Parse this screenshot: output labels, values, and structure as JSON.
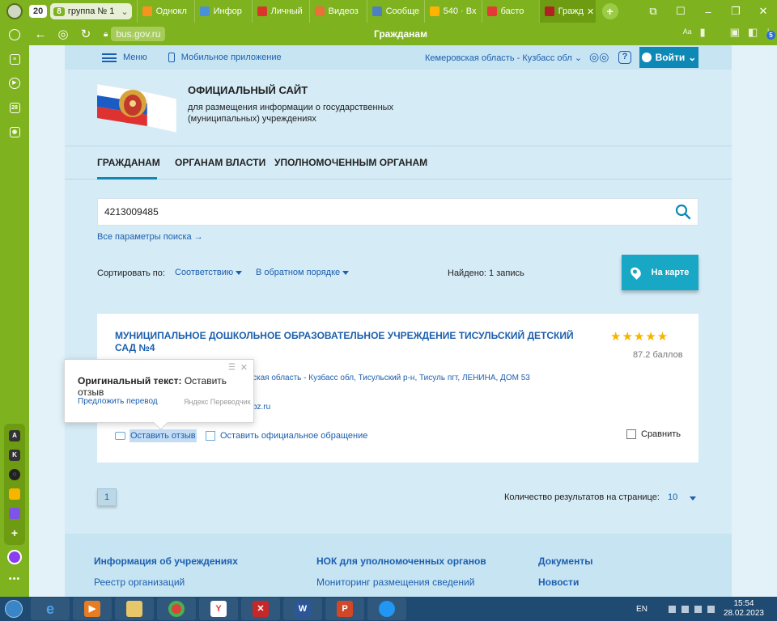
{
  "browser": {
    "tab_count": "20",
    "group": {
      "badge": "8",
      "label": "группа № 1"
    },
    "tabs": [
      {
        "label": "Однокл",
        "color": "#f7931e"
      },
      {
        "label": "Инфор",
        "color": "#4a90d9"
      },
      {
        "label": "Личный",
        "color": "#d9352b"
      },
      {
        "label": "Видеоз",
        "color": "#e8703a"
      },
      {
        "label": "Сообще",
        "color": "#4e7fc2"
      },
      {
        "label": "540 · Вх",
        "color": "#ffb300"
      },
      {
        "label": "басто",
        "color": "#e53935"
      },
      {
        "label": "Гражд",
        "color": "#b22222",
        "active": true
      }
    ],
    "new_tab": "+",
    "url": "bus.gov.ru",
    "page_title": "Гражданам"
  },
  "site": {
    "menu_label": "Меню",
    "mobile_label": "Мобильное приложение",
    "region": "Кемеровская область - Кузбасс обл",
    "login_label": "Войти",
    "help_glyph": "?",
    "title": "ОФИЦИАЛЬНЫЙ САЙТ",
    "subtitle": "для размещения информации о государственных (муниципальных) учреждениях",
    "nav": [
      "ГРАЖДАНАМ",
      "ОРГАНАМ ВЛАСТИ",
      "УПОЛНОМОЧЕННЫМ ОРГАНАМ"
    ],
    "search_value": "4213009485",
    "advanced_link": "Все параметры поиска →",
    "sort_label": "Сортировать по:",
    "sort_relevance": "Соответствию",
    "sort_order": "В обратном порядке",
    "found_text": "Найдено: 1 запись",
    "map_button": "На карте",
    "result": {
      "name": "МУНИЦИПАЛЬНОЕ ДОШКОЛЬНОЕ ОБРАЗОВАТЕЛЬНОЕ УЧРЕЖДЕНИЕ ТИСУЛЬСКИЙ ДЕТСКИЙ САД №4",
      "stars": "★★★★★",
      "rating_stars": 5,
      "score": "87.2 баллов",
      "address": "ская область - Кузбасс обл, Тисульский р-н, Тисуль пгт, ЛЕНИНА, ДОМ 53",
      "email": "bz.ru",
      "review_label": "Оставить отзыв",
      "appeal_label": "Оставить официальное обращение",
      "compare_label": "Сравнить"
    },
    "page_number": "1",
    "per_page_label": "Количество результатов на странице:",
    "per_page_value": "10",
    "footer": {
      "col1_head": "Информация об учреждениях",
      "col1_item": "Реестр организаций",
      "col2_head": "НОК для уполномоченных органов",
      "col2_item": "Мониторинг размещения сведений",
      "col3_head": "Документы",
      "col3_item": "Новости"
    }
  },
  "translate_popup": {
    "original_prefix": "Оригинальный текст:",
    "original_text": "Оставить отзыв",
    "suggest_link": "Предложить перевод",
    "provider": "Яндекс Переводчик"
  },
  "taskbar": {
    "language": "EN",
    "time": "15:54",
    "date": "28.02.2023"
  }
}
